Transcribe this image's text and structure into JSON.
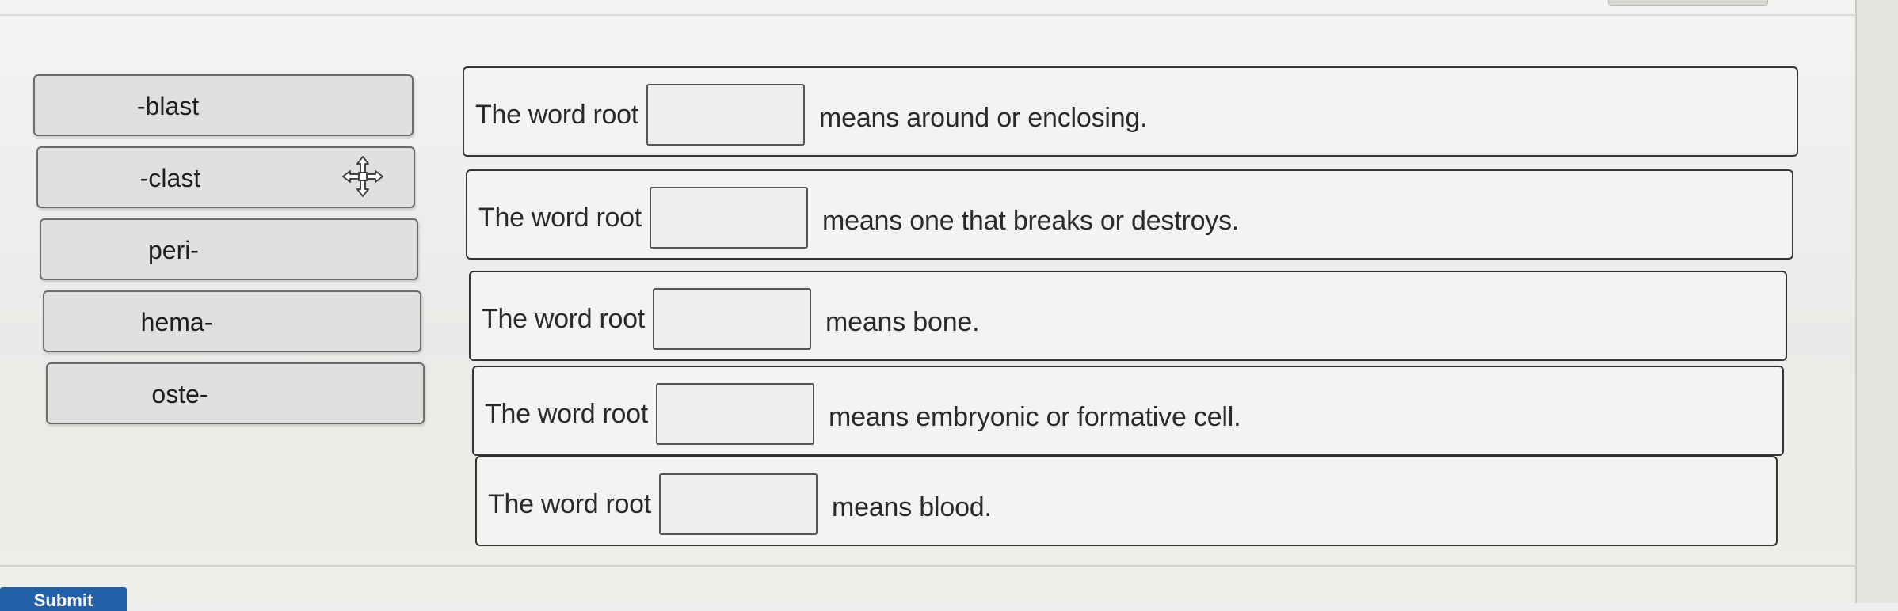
{
  "terms": [
    {
      "label": "-blast"
    },
    {
      "label": "-clast"
    },
    {
      "label": "peri-"
    },
    {
      "label": "hema-"
    },
    {
      "label": "oste-"
    }
  ],
  "rows": [
    {
      "lead": "The word root",
      "tail": "means around or enclosing."
    },
    {
      "lead": "The word root",
      "tail": "means one that breaks or destroys."
    },
    {
      "lead": "The word root",
      "tail": "means bone."
    },
    {
      "lead": "The word root",
      "tail": "means embryonic or formative cell."
    },
    {
      "lead": "The word root",
      "tail": "means blood."
    }
  ],
  "drag_cursor_icon": "move-arrows-icon",
  "submit": {
    "label": "Submit"
  },
  "colors": {
    "tile_bg": "#dfe1de",
    "row_border": "#333333",
    "submit_bg": "#2460a7"
  }
}
